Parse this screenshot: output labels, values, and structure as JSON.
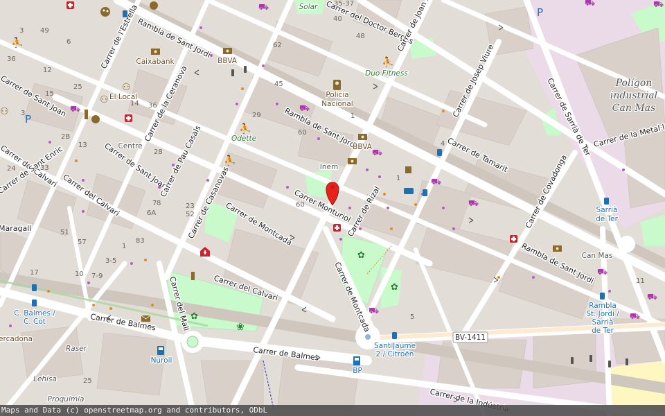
{
  "map": {
    "streets": [
      {
        "id": "rambla-sant-jordi-nw",
        "name": "Rambla de Sant Jordi"
      },
      {
        "id": "rambla-sant-jordi-mid",
        "name": "Rambla de Sant Jordi"
      },
      {
        "id": "rambla-sant-jordi-se",
        "name": "Rambla de Sant Jordi"
      },
      {
        "id": "carrer-montcada-1",
        "name": "Carrer de Montcada"
      },
      {
        "id": "carrer-montcada-2",
        "name": "Carrer de Montcada"
      },
      {
        "id": "carrer-monturiol",
        "name": "Carrer Monturiol"
      },
      {
        "id": "carrer-rizal",
        "name": "Carrer de Rizal"
      },
      {
        "id": "carrer-calvari-1",
        "name": "Carrer del Calvari"
      },
      {
        "id": "carrer-calvari-2",
        "name": "Carrer del Calvari"
      },
      {
        "id": "carrer-calvari-3",
        "name": "Carrer del Calvari"
      },
      {
        "id": "carrer-balmes-1",
        "name": "Carrer de Balmes"
      },
      {
        "id": "carrer-balmes-2",
        "name": "Carrer de Balmes"
      },
      {
        "id": "carrer-industria",
        "name": "Carrer de la Indústria"
      },
      {
        "id": "carrer-sant-joan-1",
        "name": "Carrer de Sant Joan"
      },
      {
        "id": "carrer-sant-joan-2",
        "name": "Carrer de Sant Joan"
      },
      {
        "id": "carrer-casanovas",
        "name": "Carrer de Casanovas"
      },
      {
        "id": "carrer-pau-casals",
        "name": "Carrer de Pau Casals"
      },
      {
        "id": "carrer-ceranova",
        "name": "Carrer de la Ceranova"
      },
      {
        "id": "carrer-mall",
        "name": "Carrer del Mall"
      },
      {
        "id": "carrer-estrella",
        "name": "Carrer de l'Estrella"
      },
      {
        "id": "carrer-sant-enric",
        "name": "Carrer de Sant Enric"
      },
      {
        "id": "carrer-doctor-bergos",
        "name": "Carrer del Doctor Bergós"
      },
      {
        "id": "carrer-joan-miro",
        "name": "Carrer de Joan Miró"
      },
      {
        "id": "carrer-josep-viure",
        "name": "Carrer de Josep Viure"
      },
      {
        "id": "carrer-tamarit",
        "name": "Carrer de Tamarit"
      },
      {
        "id": "carrer-covadonga",
        "name": "Carrer de Covadonga"
      },
      {
        "id": "carrer-sarria-ter",
        "name": "Carrer de Sarrià de Ter"
      },
      {
        "id": "carrer-metallurgia",
        "name": "Carrer de la Metal·lúrgia"
      },
      {
        "id": "maragall",
        "name": "Maragall"
      }
    ],
    "pois": [
      {
        "id": "caixabank",
        "name": "Caixabank"
      },
      {
        "id": "bbva-1",
        "name": "BBVA"
      },
      {
        "id": "bbva-2",
        "name": "BBVA"
      },
      {
        "id": "el-local",
        "name": "El Local"
      },
      {
        "id": "centre",
        "name": "Centre"
      },
      {
        "id": "odette",
        "name": "Odette"
      },
      {
        "id": "policia",
        "name": "Policia\nNacional"
      },
      {
        "id": "inem",
        "name": "Inem"
      },
      {
        "id": "duo-fitness",
        "name": "Duo Fitness"
      },
      {
        "id": "solar",
        "name": "Solar"
      },
      {
        "id": "nuroil",
        "name": "Nuroil"
      },
      {
        "id": "bp",
        "name": "BP"
      },
      {
        "id": "raser",
        "name": "Raser"
      },
      {
        "id": "lehisa",
        "name": "Lehisa"
      },
      {
        "id": "proquimia",
        "name": "Proquimia"
      },
      {
        "id": "mercadona",
        "name": "Mercadona"
      },
      {
        "id": "can-mas",
        "name": "Can Mas"
      }
    ],
    "stops": [
      {
        "id": "sarria-de-ter",
        "lines": [
          "Sarrià",
          "de Ter"
        ]
      },
      {
        "id": "rambla-sant-jordi-stop",
        "lines": [
          "Rambla",
          "St. Jordi /",
          "Sarrià",
          "de Ter"
        ]
      },
      {
        "id": "c-balmes",
        "lines": [
          "C. Balmes /",
          "C. Cot"
        ]
      },
      {
        "id": "sant-jaume",
        "lines": [
          "Sant Jaume",
          "2 / Citroën"
        ]
      }
    ],
    "area_label": [
      "Polígon",
      "industrial",
      "Can Mas"
    ],
    "road_ref": "BV-1411",
    "house_numbers": [
      "35-37",
      "40",
      "48",
      "62",
      "45",
      "29",
      "60",
      "60",
      "1",
      "36",
      "14",
      "49",
      "3",
      "6",
      "12",
      "25",
      "15",
      "36",
      "3",
      "2B",
      "28",
      "33",
      "24",
      "51",
      "57",
      "7",
      "8",
      "6A",
      "23",
      "52",
      "83",
      "1",
      "3-5",
      "7-9",
      "10",
      "17",
      "11",
      "5",
      "4",
      "25",
      "13",
      "1"
    ],
    "colors": {
      "road": "#ffffff",
      "road_outline": "#cfc7bd",
      "building": "#d9d0c9",
      "block": "#e5dfd8",
      "park": "#c8facc",
      "industrial": "#ebdbe8",
      "marker": "#e8221b",
      "primary": "#fcd6a4"
    }
  },
  "attribution": "Maps and Data (c) openstreetmap.org and contributors, ODbL"
}
